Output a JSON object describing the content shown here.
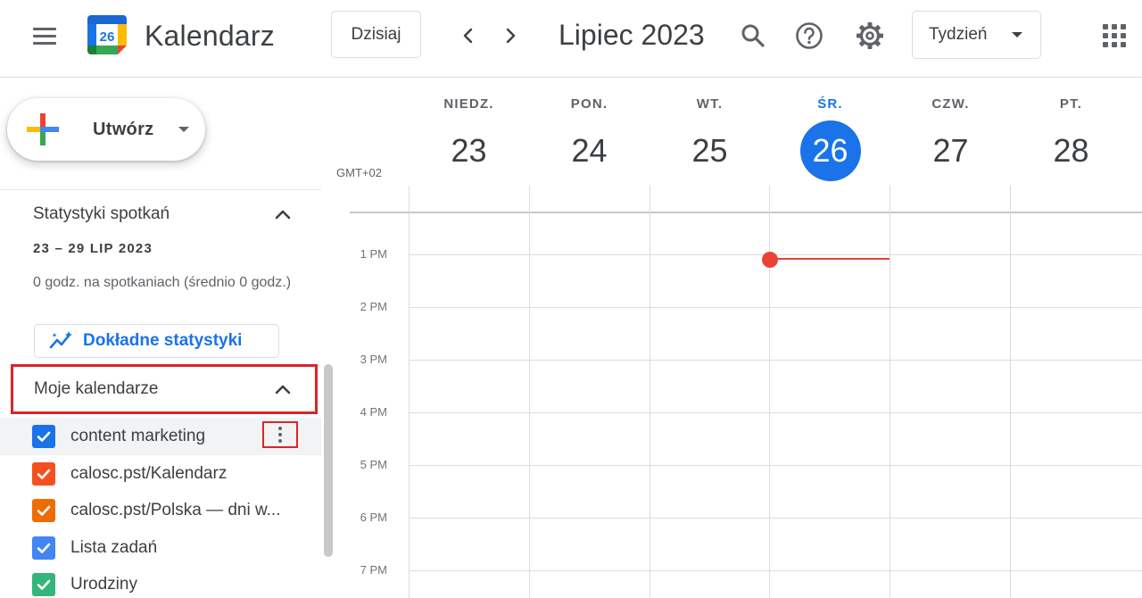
{
  "app": {
    "title": "Kalendarz",
    "logo_day": "26"
  },
  "toolbar": {
    "today_label": "Dzisiaj",
    "period_title": "Lipiec 2023",
    "view_label": "Tydzień",
    "icons": [
      "menu-icon",
      "chevron-left-icon",
      "chevron-right-icon",
      "search-icon",
      "help-icon",
      "gear-icon",
      "apps-grid-icon"
    ]
  },
  "sidebar": {
    "create_label": "Utwórz",
    "stats": {
      "title": "Statystyki spotkań",
      "range": "23 – 29 LIP 2023",
      "summary": "0 godz. na spotkaniach (średnio 0 godz.)",
      "details_label": "Dokładne statystyki"
    },
    "my_calendars": {
      "title": "Moje kalendarze",
      "items": [
        {
          "label": "content marketing",
          "color": "#1a73e8"
        },
        {
          "label": "calosc.pst/Kalendarz",
          "color": "#f4511e"
        },
        {
          "label": "calosc.pst/Polska — dni w...",
          "color": "#ef6c00"
        },
        {
          "label": "Lista zadań",
          "color": "#4285f4"
        },
        {
          "label": "Urodziny",
          "color": "#33b679"
        }
      ]
    }
  },
  "week": {
    "timezone": "GMT+02",
    "days": [
      {
        "name": "NIEDZ.",
        "num": "23"
      },
      {
        "name": "PON.",
        "num": "24"
      },
      {
        "name": "WT.",
        "num": "25"
      },
      {
        "name": "ŚR.",
        "num": "26",
        "today": true
      },
      {
        "name": "CZW.",
        "num": "27"
      },
      {
        "name": "PT.",
        "num": "28"
      }
    ],
    "hours": [
      "1 PM",
      "2 PM",
      "3 PM",
      "4 PM",
      "5 PM",
      "6 PM",
      "7 PM"
    ]
  },
  "colors": {
    "accent": "#1a73e8",
    "now_indicator": "#ea4335",
    "highlight_box": "#d9252a"
  }
}
